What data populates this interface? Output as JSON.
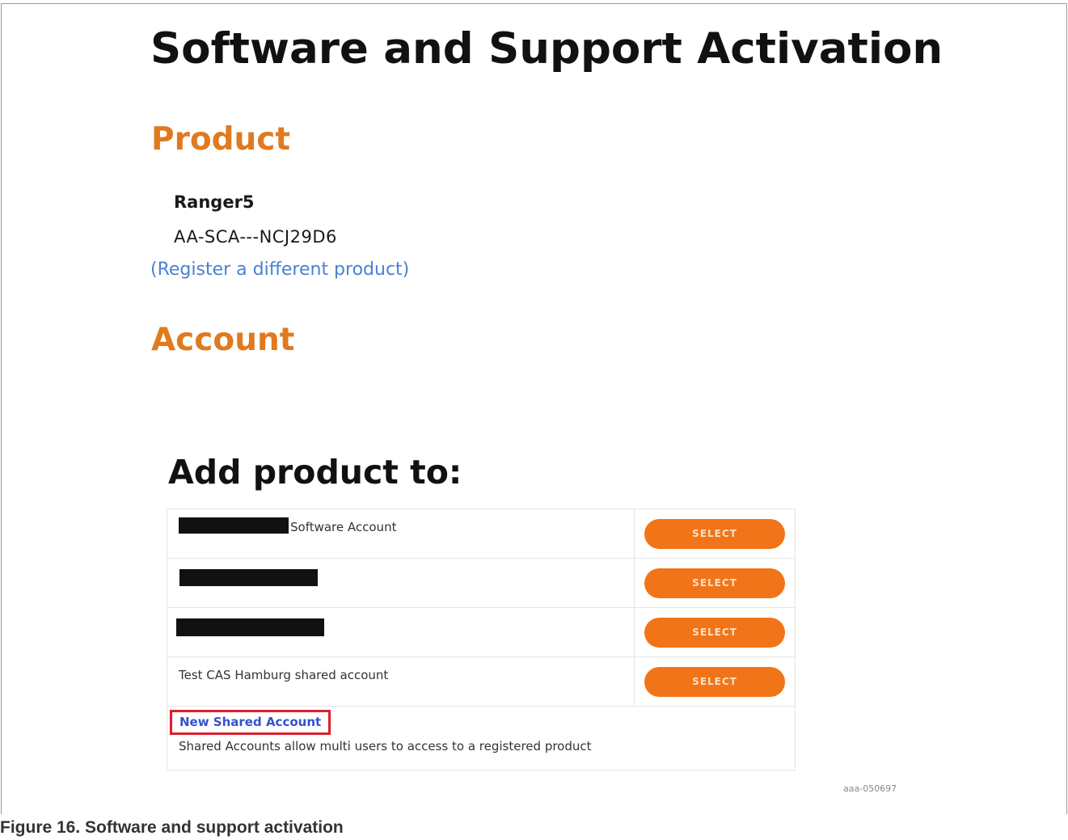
{
  "page": {
    "title": "Software and Support Activation",
    "figure_id": "aaa-050697",
    "caption": "Figure 16.  Software and support activation"
  },
  "product": {
    "heading": "Product",
    "name": "Ranger5",
    "code": "AA-SCA---NCJ29D6",
    "register_link": "(Register a different product)"
  },
  "account": {
    "heading": "Account"
  },
  "add_product": {
    "heading": "Add product to:",
    "rows": [
      {
        "label": "Software Account",
        "button": "SELECT"
      },
      {
        "label": "",
        "button": "SELECT"
      },
      {
        "label": "",
        "button": "SELECT"
      },
      {
        "label": "Test CAS Hamburg shared account",
        "button": "SELECT"
      }
    ],
    "new_shared_link": "New Shared Account",
    "shared_description": "Shared Accounts allow multi users to access to a registered product"
  },
  "colors": {
    "section_heading": "#e07a1f",
    "select_button": "#f27418",
    "link": "#4a80d6",
    "highlight_box": "#d9202e"
  }
}
